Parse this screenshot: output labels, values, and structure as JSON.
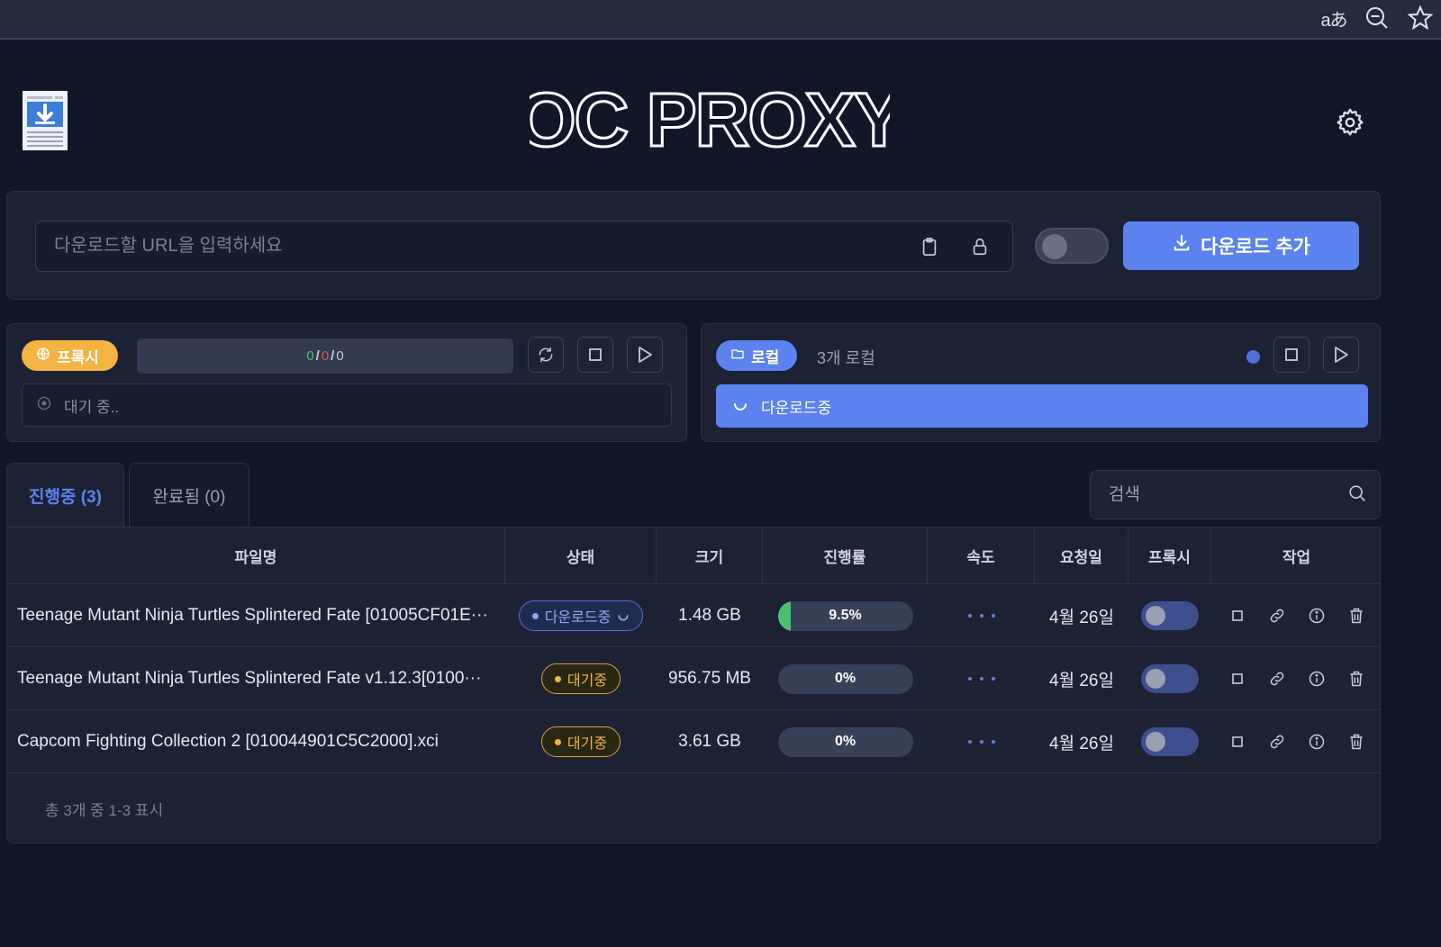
{
  "browser": {
    "icons": [
      "translate-icon",
      "zoom-out-icon",
      "star-icon"
    ],
    "translate_glyph": "aあ"
  },
  "header": {
    "brand": "OC PROXY",
    "logo_icon": "download-document-icon",
    "settings_icon": "gear-icon"
  },
  "url_bar": {
    "placeholder": "다운로드할 URL을 입력하세요",
    "value": "",
    "add_button_label": "다운로드 추가",
    "toggle_on": false
  },
  "proxy_panel": {
    "label": "프록시",
    "count_success": "0",
    "count_fail": "0",
    "count_total": "0",
    "sep": "/",
    "status_text": "대기 중.."
  },
  "local_panel": {
    "label": "로컬",
    "count_text": "3개 로컬",
    "progress_text": "다운로드중"
  },
  "tabs": {
    "active_label": "진행중 (3)",
    "done_label": "완료됨 (0)"
  },
  "search": {
    "placeholder": "검색"
  },
  "table": {
    "columns": [
      "파일명",
      "상태",
      "크기",
      "진행률",
      "속도",
      "요청일",
      "프록시",
      "작업"
    ],
    "rows": [
      {
        "name": "Teenage Mutant Ninja Turtles Splintered Fate [01005CF01E···",
        "status": "다운로드중",
        "status_kind": "downloading",
        "size": "1.48 GB",
        "progress_label": "9.5%",
        "progress": 0.095,
        "date": "4월 26일",
        "proxy_on": false
      },
      {
        "name": "Teenage Mutant Ninja Turtles Splintered Fate v1.12.3[0100···",
        "status": "대기중",
        "status_kind": "waiting",
        "size": "956.75 MB",
        "progress_label": "0%",
        "progress": 0,
        "date": "4월 26일",
        "proxy_on": false
      },
      {
        "name": "Capcom Fighting Collection 2 [010044901C5C2000].xci",
        "status": "대기중",
        "status_kind": "waiting",
        "size": "3.61 GB",
        "progress_label": "0%",
        "progress": 0,
        "date": "4월 26일",
        "proxy_on": false
      }
    ],
    "footer": "총 3개 중 1-3 표시"
  },
  "colors": {
    "accent": "#5b82ee",
    "proxy": "#f3b444",
    "success": "#4fbf73",
    "error": "#e0554e"
  }
}
